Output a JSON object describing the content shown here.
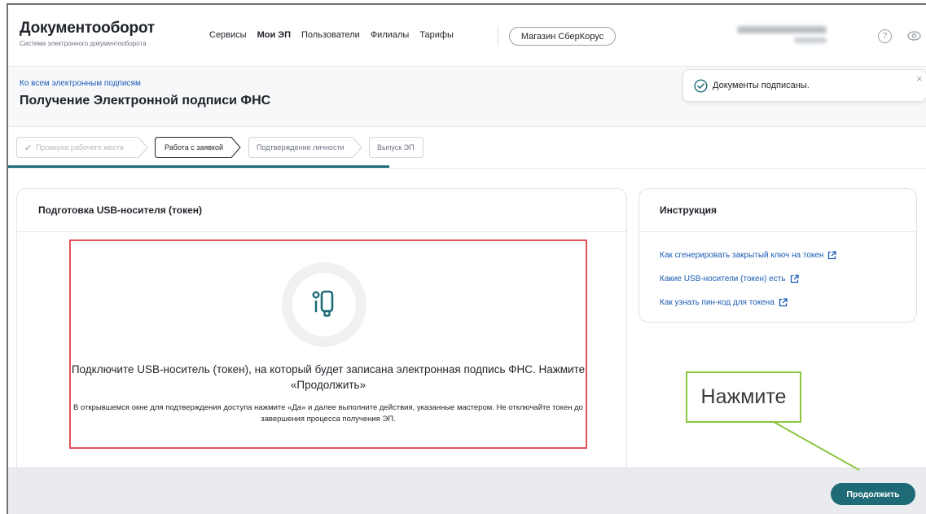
{
  "header": {
    "app_title": "Документооборот",
    "app_subtitle": "Система электронного документооборота",
    "nav": [
      "Сервисы",
      "Мои ЭП",
      "Пользователи",
      "Филиалы",
      "Тарифы"
    ],
    "nav_active_index": 1,
    "shop_button": "Магазин СберКорус",
    "help_glyph": "?"
  },
  "breadcrumb": "Ко всем электронным подписям",
  "page_title": "Получение Электронной подписи ФНС",
  "toast": {
    "text": "Документы подписаны.",
    "close_glyph": "×"
  },
  "steps": [
    {
      "label": "Проверка рабочего места",
      "state": "done"
    },
    {
      "label": "Работа с заявкой",
      "state": "active"
    },
    {
      "label": "Подтверждение личности",
      "state": "pending"
    },
    {
      "label": "Выпуск ЭП",
      "state": "pending"
    }
  ],
  "main_card": {
    "title": "Подготовка USB-носителя (токен)",
    "icon": "usb-token-icon",
    "main_text": "Подключите USB-носитель (токен), на который будет записана электронная подпись ФНС. Нажмите «Продолжить»",
    "sub_text": "В открывшемся окне для подтверждения доступа нажмите «Да» и далее выполните действия, указанные мастером. Не отключайте токен до завершения процесса получения ЭП."
  },
  "instruction": {
    "title": "Инструкция",
    "links": [
      "Как сгенерировать закрытый ключ на токен",
      "Какие USB-носители (токен) есть",
      "Как узнать пин-код для токена"
    ]
  },
  "footer": {
    "continue_button": "Продолжить"
  },
  "annotation": {
    "callout_text": "Нажмите"
  },
  "colors": {
    "accent": "#1e6b77",
    "link": "#1a5bb5",
    "highlight_box": "#e05258",
    "callout_border": "#8cc63f"
  }
}
